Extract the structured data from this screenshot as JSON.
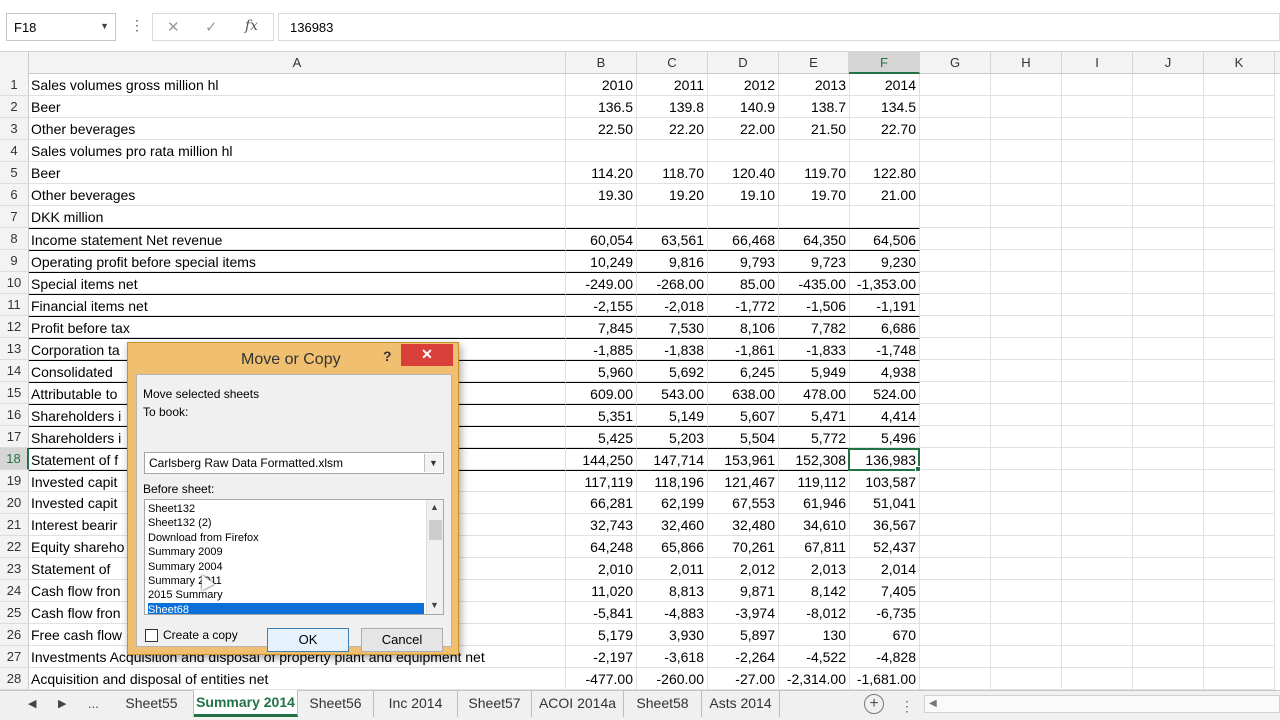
{
  "formula_bar": {
    "name_box": "F18",
    "cancel_icon": "✕",
    "enter_icon": "✓",
    "fx_label": "fx",
    "value": "136983"
  },
  "grid": {
    "columns": [
      "A",
      "B",
      "C",
      "D",
      "E",
      "F",
      "G",
      "H",
      "I",
      "J",
      "K"
    ],
    "selected_cell": "F18",
    "rows": [
      {
        "n": "1",
        "a": "Sales volumes gross million hl",
        "b": "2010",
        "c": "2011",
        "d": "2012",
        "e": "2013",
        "f": "2014"
      },
      {
        "n": "2",
        "a": "Beer",
        "b": "136.5",
        "c": "139.8",
        "d": "140.9",
        "e": "138.7",
        "f": "134.5"
      },
      {
        "n": "3",
        "a": "Other beverages",
        "b": "22.50",
        "c": "22.20",
        "d": "22.00",
        "e": "21.50",
        "f": "22.70"
      },
      {
        "n": "4",
        "a": "Sales volumes pro rata million hl",
        "b": "",
        "c": "",
        "d": "",
        "e": "",
        "f": ""
      },
      {
        "n": "5",
        "a": "Beer",
        "b": "114.20",
        "c": "118.70",
        "d": "120.40",
        "e": "119.70",
        "f": "122.80"
      },
      {
        "n": "6",
        "a": "Other beverages",
        "b": "19.30",
        "c": "19.20",
        "d": "19.10",
        "e": "19.70",
        "f": "21.00"
      },
      {
        "n": "7",
        "a": "DKK million",
        "b": "",
        "c": "",
        "d": "",
        "e": "",
        "f": ""
      },
      {
        "n": "8",
        "a": "Income statement Net revenue",
        "b": "60,054",
        "c": "63,561",
        "d": "66,468",
        "e": "64,350",
        "f": "64,506"
      },
      {
        "n": "9",
        "a": "Operating profit before special items",
        "b": "10,249",
        "c": "9,816",
        "d": "9,793",
        "e": "9,723",
        "f": "9,230"
      },
      {
        "n": "10",
        "a": "Special items net",
        "b": "-249.00",
        "c": "-268.00",
        "d": "85.00",
        "e": "-435.00",
        "f": "-1,353.00"
      },
      {
        "n": "11",
        "a": "Financial items net",
        "b": "-2,155",
        "c": "-2,018",
        "d": "-1,772",
        "e": "-1,506",
        "f": "-1,191"
      },
      {
        "n": "12",
        "a": "Profit before tax",
        "b": "7,845",
        "c": "7,530",
        "d": "8,106",
        "e": "7,782",
        "f": "6,686"
      },
      {
        "n": "13",
        "a": "Corporation ta",
        "b": "-1,885",
        "c": "-1,838",
        "d": "-1,861",
        "e": "-1,833",
        "f": "-1,748"
      },
      {
        "n": "14",
        "a": "Consolidated",
        "b": "5,960",
        "c": "5,692",
        "d": "6,245",
        "e": "5,949",
        "f": "4,938"
      },
      {
        "n": "15",
        "a": "Attributable to",
        "b": "609.00",
        "c": "543.00",
        "d": "638.00",
        "e": "478.00",
        "f": "524.00"
      },
      {
        "n": "16",
        "a": "Shareholders i",
        "b": "5,351",
        "c": "5,149",
        "d": "5,607",
        "e": "5,471",
        "f": "4,414"
      },
      {
        "n": "17",
        "a": "Shareholders i",
        "b": "5,425",
        "c": "5,203",
        "d": "5,504",
        "e": "5,772",
        "f": "5,496"
      },
      {
        "n": "18",
        "a": "Statement of f",
        "b": "144,250",
        "c": "147,714",
        "d": "153,961",
        "e": "152,308",
        "f": "136,983"
      },
      {
        "n": "19",
        "a": "Invested capit",
        "b": "117,119",
        "c": "118,196",
        "d": "121,467",
        "e": "119,112",
        "f": "103,587"
      },
      {
        "n": "20",
        "a": "Invested capit",
        "b": "66,281",
        "c": "62,199",
        "d": "67,553",
        "e": "61,946",
        "f": "51,041"
      },
      {
        "n": "21",
        "a": "Interest bearir",
        "b": "32,743",
        "c": "32,460",
        "d": "32,480",
        "e": "34,610",
        "f": "36,567"
      },
      {
        "n": "22",
        "a": "Equity shareho",
        "b": "64,248",
        "c": "65,866",
        "d": "70,261",
        "e": "67,811",
        "f": "52,437"
      },
      {
        "n": "23",
        "a": " Statement of",
        "b": "2,010",
        "c": "2,011",
        "d": "2,012",
        "e": "2,013",
        "f": "2,014"
      },
      {
        "n": "24",
        "a": "Cash flow fron",
        "b": "11,020",
        "c": "8,813",
        "d": "9,871",
        "e": "8,142",
        "f": "7,405"
      },
      {
        "n": "25",
        "a": "Cash flow fron",
        "b": "-5,841",
        "c": "-4,883",
        "d": "-3,974",
        "e": "-8,012",
        "f": "-6,735"
      },
      {
        "n": "26",
        "a": "Free cash flow",
        "b": "5,179",
        "c": "3,930",
        "d": "5,897",
        "e": "130",
        "f": "670"
      },
      {
        "n": "27",
        "a": "Investments Acquisition and disposal of property plant and equipment net",
        "b": "-2,197",
        "c": "-3,618",
        "d": "-2,264",
        "e": "-4,522",
        "f": "-4,828"
      },
      {
        "n": "28",
        "a": "Acquisition and disposal of entities net",
        "b": "-477.00",
        "c": "-260.00",
        "d": "-27.00",
        "e": "-2,314.00",
        "f": "-1,681.00"
      }
    ]
  },
  "tabs": {
    "nav_prev": "◀",
    "nav_next": "▶",
    "ellipsis": "...",
    "items": [
      "Sheet55",
      "Summary 2014",
      "Sheet56",
      "Inc 2014",
      "Sheet57",
      "ACOI 2014a",
      "Sheet58",
      "Asts 2014"
    ],
    "active": "Summary 2014",
    "add_icon": "+",
    "accent": "#217346"
  },
  "dialog": {
    "title": "Move or Copy",
    "help": "?",
    "close": "✕",
    "move_label": "Move selected sheets",
    "to_book_label": "To book:",
    "to_book_value": "Carlsberg Raw Data Formatted.xlsm",
    "before_sheet_label": "Before sheet:",
    "sheet_list": [
      "Sheet132",
      "Sheet132 (2)",
      "Download from Firefox",
      "Summary 2009",
      "Summary 2004",
      "Summary 2011",
      "2015 Summary",
      "Sheet68"
    ],
    "selected_sheet": "Sheet68",
    "create_copy_label": "Create a copy",
    "create_copy_checked": false,
    "ok_label": "OK",
    "cancel_label": "Cancel"
  }
}
